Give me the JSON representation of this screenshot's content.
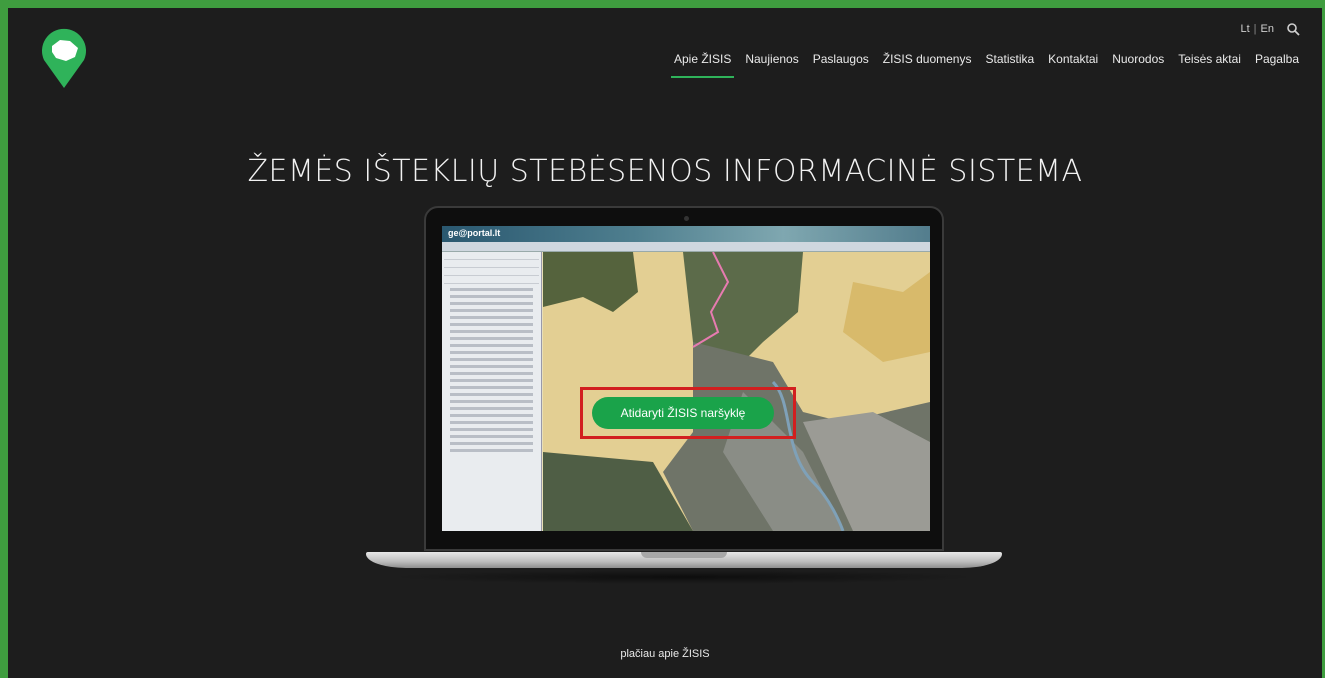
{
  "header": {
    "lang": {
      "lt": "Lt",
      "sep": "|",
      "en": "En"
    },
    "icons": {
      "logo": "lithuania-map-pin-logo",
      "search": "search-icon"
    },
    "colors": {
      "accent": "#2fb35a",
      "frame": "#3f9d3f",
      "background": "#1d1d1d"
    }
  },
  "nav": {
    "items": [
      {
        "label": "Apie ŽISIS",
        "active": true
      },
      {
        "label": "Naujienos"
      },
      {
        "label": "Paslaugos"
      },
      {
        "label": "ŽISIS duomenys"
      },
      {
        "label": "Statistika"
      },
      {
        "label": "Kontaktai"
      },
      {
        "label": "Nuorodos"
      },
      {
        "label": "Teisės aktai"
      },
      {
        "label": "Pagalba"
      }
    ]
  },
  "hero": {
    "title": "ŽEMĖS IŠTEKLIŲ STEBĖSENOS INFORMACINĖ SISTEMA",
    "screen_brand": "ge@portal.lt",
    "cta_label": "Atidaryti ŽISIS naršyklę",
    "cta_highlight_color": "#d21f1f",
    "cta_color": "#1aa34a"
  },
  "footer": {
    "more_label": "plačiau apie ŽISIS"
  }
}
